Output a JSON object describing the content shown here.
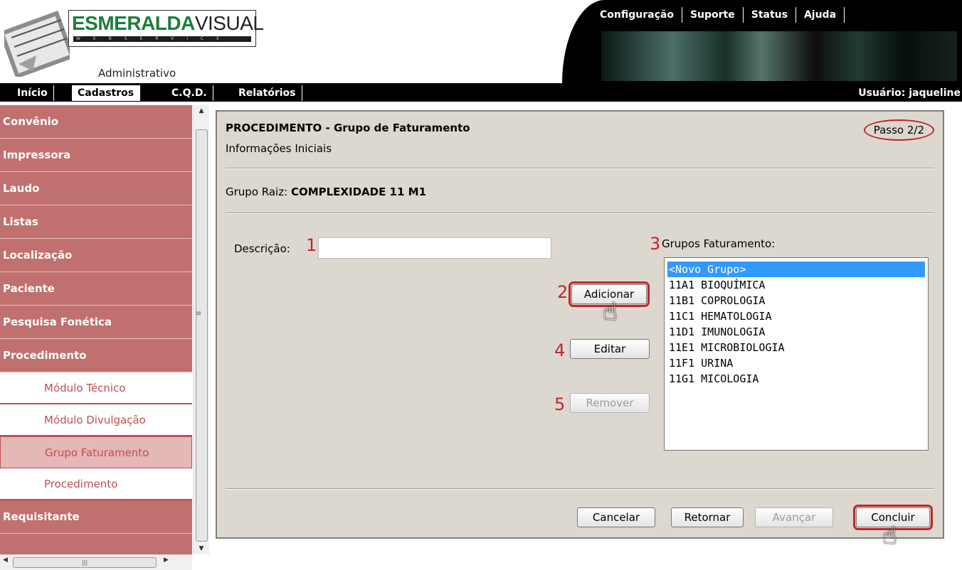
{
  "brand": {
    "logo_part1": "ESMERALDA",
    "logo_part2": "VISUAL",
    "strip": "WEBSERVICE",
    "subtitle": "Administrativo"
  },
  "topnav": [
    "Configuração",
    "Suporte",
    "Status",
    "Ajuda"
  ],
  "navbar": {
    "items": [
      "Início",
      "Cadastros",
      "C.Q.D.",
      "Relatórios"
    ],
    "active": "Cadastros",
    "user": "Usuário: jaqueline"
  },
  "sidebar": {
    "items": [
      "Convênio",
      "Impressora",
      "Laudo",
      "Listas",
      "Localização",
      "Paciente",
      "Pesquisa Fonética",
      "Procedimento"
    ],
    "subitems": [
      "Módulo Técnico",
      "Módulo Divulgação",
      "Grupo Faturamento",
      "Procedimento"
    ],
    "selected_sub": "Grupo Faturamento",
    "after": [
      "Requisitante"
    ]
  },
  "panel": {
    "title": "PROCEDIMENTO - Grupo de Faturamento",
    "subtitle": "Informações Iniciais",
    "step": "Passo 2/2",
    "grupo_raiz_label": "Grupo Raiz:",
    "grupo_raiz_value": "COMPLEXIDADE 11 M1",
    "descricao_label": "Descrição:",
    "descricao_value": "",
    "grupos_label": "Grupos Faturamento:",
    "grupos": [
      "<Novo Grupo>",
      "11A1 BIOQUÍMICA",
      "11B1 COPROLOGIA",
      "11C1 HEMATOLOGIA",
      "11D1 IMUNOLOGIA",
      "11E1 MICROBIOLOGIA",
      "11F1 URINA",
      "11G1 MICOLOGIA"
    ],
    "selected_group": "<Novo Grupo>",
    "buttons": {
      "adicionar": "Adicionar",
      "editar": "Editar",
      "remover": "Remover",
      "cancelar": "Cancelar",
      "retornar": "Retornar",
      "avancar": "Avançar",
      "concluir": "Concluir"
    },
    "markers": {
      "m1": "1",
      "m2": "2",
      "m3": "3",
      "m4": "4",
      "m5": "5"
    }
  },
  "colors": {
    "sidebar_bg": "#c0706e",
    "panel_bg": "#dcd8d0",
    "highlight_red": "#c0262a",
    "selection_blue": "#3399ff"
  }
}
